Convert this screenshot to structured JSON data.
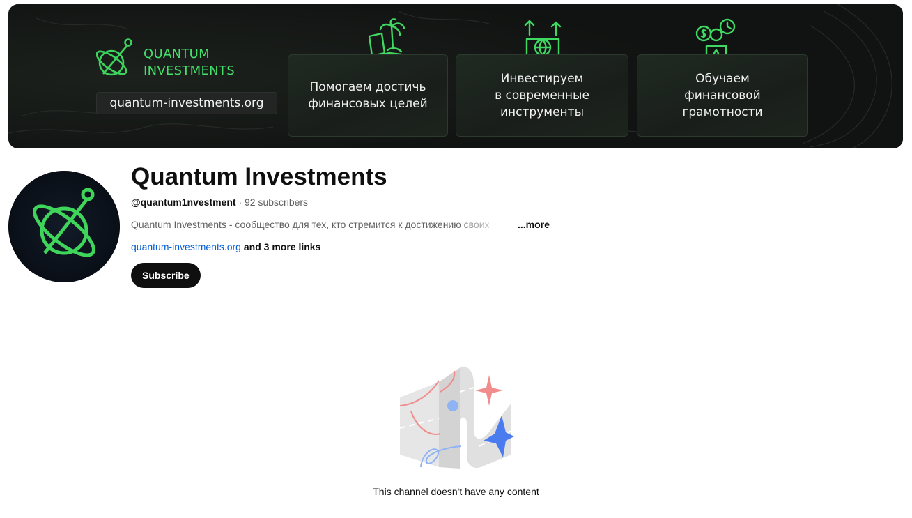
{
  "banner": {
    "brand_line1": "QUANTUM",
    "brand_line2": "INVESTMENTS",
    "brand_url": "quantum-investments.org",
    "cards": [
      {
        "lines": [
          "Помогаем достичь",
          "финансовых целей"
        ],
        "icon": "laptop-palm-tree-icon"
      },
      {
        "lines": [
          "Инвестируем",
          "в современные",
          "инструменты"
        ],
        "icon": "laptop-globe-growth-icon"
      },
      {
        "lines": [
          "Обучаем",
          "финансовой",
          "грамотности"
        ],
        "icon": "coins-clock-person-icon"
      }
    ],
    "accent_color": "#44e06a"
  },
  "channel": {
    "title": "Quantum Investments",
    "handle": "@quantum1nvestment",
    "separator": " · ",
    "subscribers": "92 subscribers",
    "description": "Quantum Investments - сообщество для тех, кто стремится к достижению своих",
    "more_label": "...more",
    "link_text": "quantum-investments.org",
    "more_links_text": " and 3 more links",
    "subscribe_label": "Subscribe"
  },
  "empty_state": {
    "message": "This channel doesn't have any content",
    "icon": "empty-channel-illustration"
  }
}
